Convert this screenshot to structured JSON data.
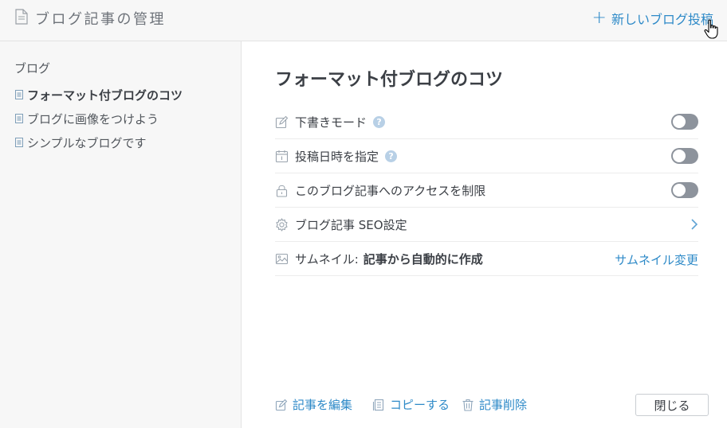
{
  "header": {
    "title": "ブログ記事の管理",
    "new_post_plus": "+",
    "new_post_label": "新しいブログ投稿"
  },
  "sidebar": {
    "root_label": "ブログ",
    "items": [
      {
        "label": "フォーマット付ブログのコツ",
        "active": true
      },
      {
        "label": "ブログに画像をつけよう",
        "active": false
      },
      {
        "label": "シンプルなブログです",
        "active": false
      }
    ]
  },
  "main": {
    "post_title": "フォーマット付ブログのコツ",
    "settings": [
      {
        "label": "下書きモード",
        "help": "?",
        "control": "toggle",
        "on": false
      },
      {
        "label": "投稿日時を指定",
        "help": "?",
        "control": "toggle",
        "on": false
      },
      {
        "label": "このブログ記事へのアクセスを制限",
        "control": "toggle",
        "on": false
      },
      {
        "label": "ブログ記事 SEO設定",
        "control": "chevron"
      },
      {
        "label": "サムネイル:",
        "value": "記事から自動的に作成",
        "action": "サムネイル変更"
      }
    ],
    "footer": {
      "edit_label": "記事を編集",
      "copy_label": "コピーする",
      "delete_label": "記事削除",
      "close_label": "閉じる"
    }
  },
  "colors": {
    "accent": "#2e8ac8",
    "sidebar_bg": "#f7f7f7",
    "toggle_off": "#8d939c",
    "help_badge": "#b8d0e6",
    "text": "#3b3f45"
  },
  "icons": {
    "header": "document-icon",
    "sidebar_item": "page-icon",
    "draft": "pencil-icon",
    "schedule": "calendar-icon",
    "restrict": "lock-icon",
    "seo": "gear-icon",
    "thumbnail": "image-icon",
    "edit": "pencil-icon",
    "copy": "copy-icon",
    "delete": "trash-icon",
    "cursor": "hand-pointer-icon"
  }
}
